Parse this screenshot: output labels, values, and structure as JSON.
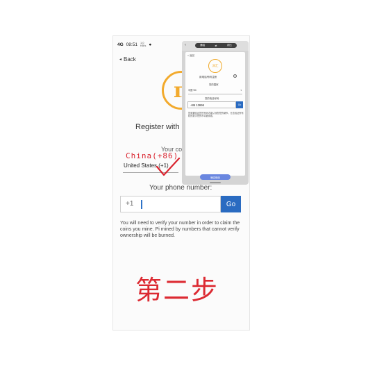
{
  "status_bar": {
    "signal": "4G",
    "time": "08:51",
    "speed_top": "1.0",
    "speed_bottom": "KB/s"
  },
  "header": {
    "back_label": "Back"
  },
  "register": {
    "title": "Register with p",
    "your_country_label": "Your co",
    "country_value": "United States (+1)"
  },
  "annotation": {
    "handwritten_country": "China(+86)",
    "step_text": "第二步"
  },
  "phone": {
    "label": "Your phone number:",
    "country_code": "+1",
    "go_label": "Go"
  },
  "help_text": "You will need to verify your number in order to claim the coins you mine. Pi mined by numbers that cannot verify ownership will be burned.",
  "overlay": {
    "top_tabs": [
      "通话",
      "⇄",
      "对比"
    ],
    "back": "< 返回",
    "logo": "派汇",
    "title": "用电话号码注册",
    "help_icon": "?",
    "country_label": "您的国家",
    "country_value": "中国+86",
    "phone_label": "您的电话号码",
    "phone_value": "+86 13696",
    "go_label": "Go",
    "note": "您需要验证您的号码才能认领您挖的硬币。无法验证所有权的数字挖的币将被烧毁。",
    "bottom_button": "确定继续"
  },
  "colors": {
    "pi_gold": "#f2aa2d",
    "go_blue": "#2a6bc1",
    "annotation_red": "#d9232e"
  }
}
